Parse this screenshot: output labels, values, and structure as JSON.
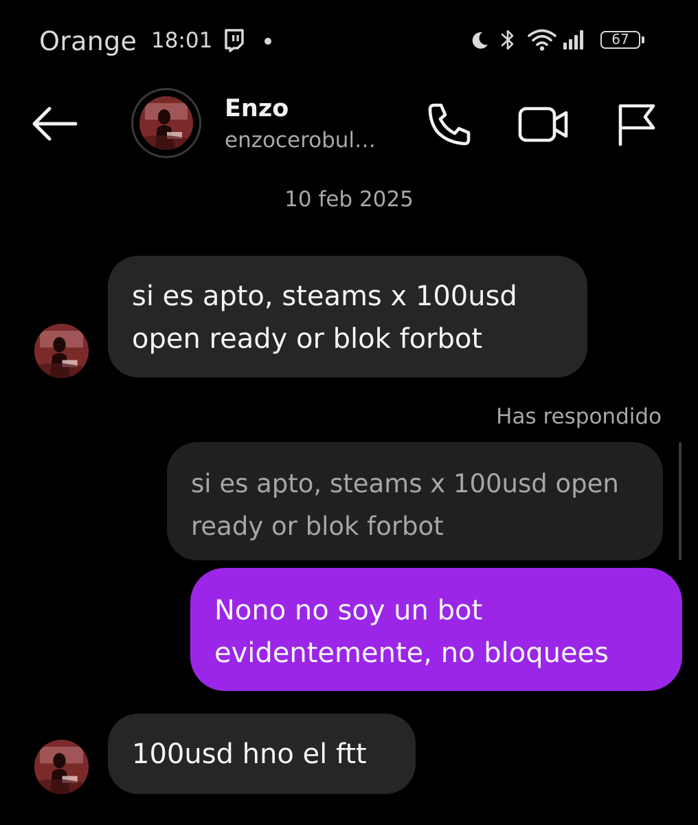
{
  "status_bar": {
    "carrier": "Orange",
    "time": "18:01",
    "battery_percent": "67",
    "icons": [
      "twitch-icon",
      "moon-icon",
      "bluetooth-icon",
      "wifi-icon",
      "signal-icon",
      "battery-icon"
    ]
  },
  "header": {
    "back_icon": "arrow-left-icon",
    "contact_name": "Enzo",
    "contact_handle": "enzocerobul…",
    "actions": [
      "phone-icon",
      "video-camera-icon",
      "flag-icon"
    ]
  },
  "chat": {
    "date": "10 feb 2025",
    "messages": [
      {
        "direction": "incoming",
        "lines": [
          "si es apto, steams x 100usd",
          "open ready or blok forbot"
        ]
      },
      {
        "direction": "outgoing",
        "reply_label": "Has respondido",
        "quoted_lines": [
          "si es apto, steams x 100usd open",
          "ready or blok forbot"
        ],
        "lines": [
          "Nono no soy un bot",
          "evidentemente, no bloquees"
        ]
      },
      {
        "direction": "incoming",
        "lines": [
          "100usd hno el ftt"
        ]
      }
    ]
  },
  "colors": {
    "background": "#000000",
    "incoming_bubble": "#262626",
    "outgoing_bubble": "#9b26e8",
    "secondary_text": "#a8a8a8"
  }
}
